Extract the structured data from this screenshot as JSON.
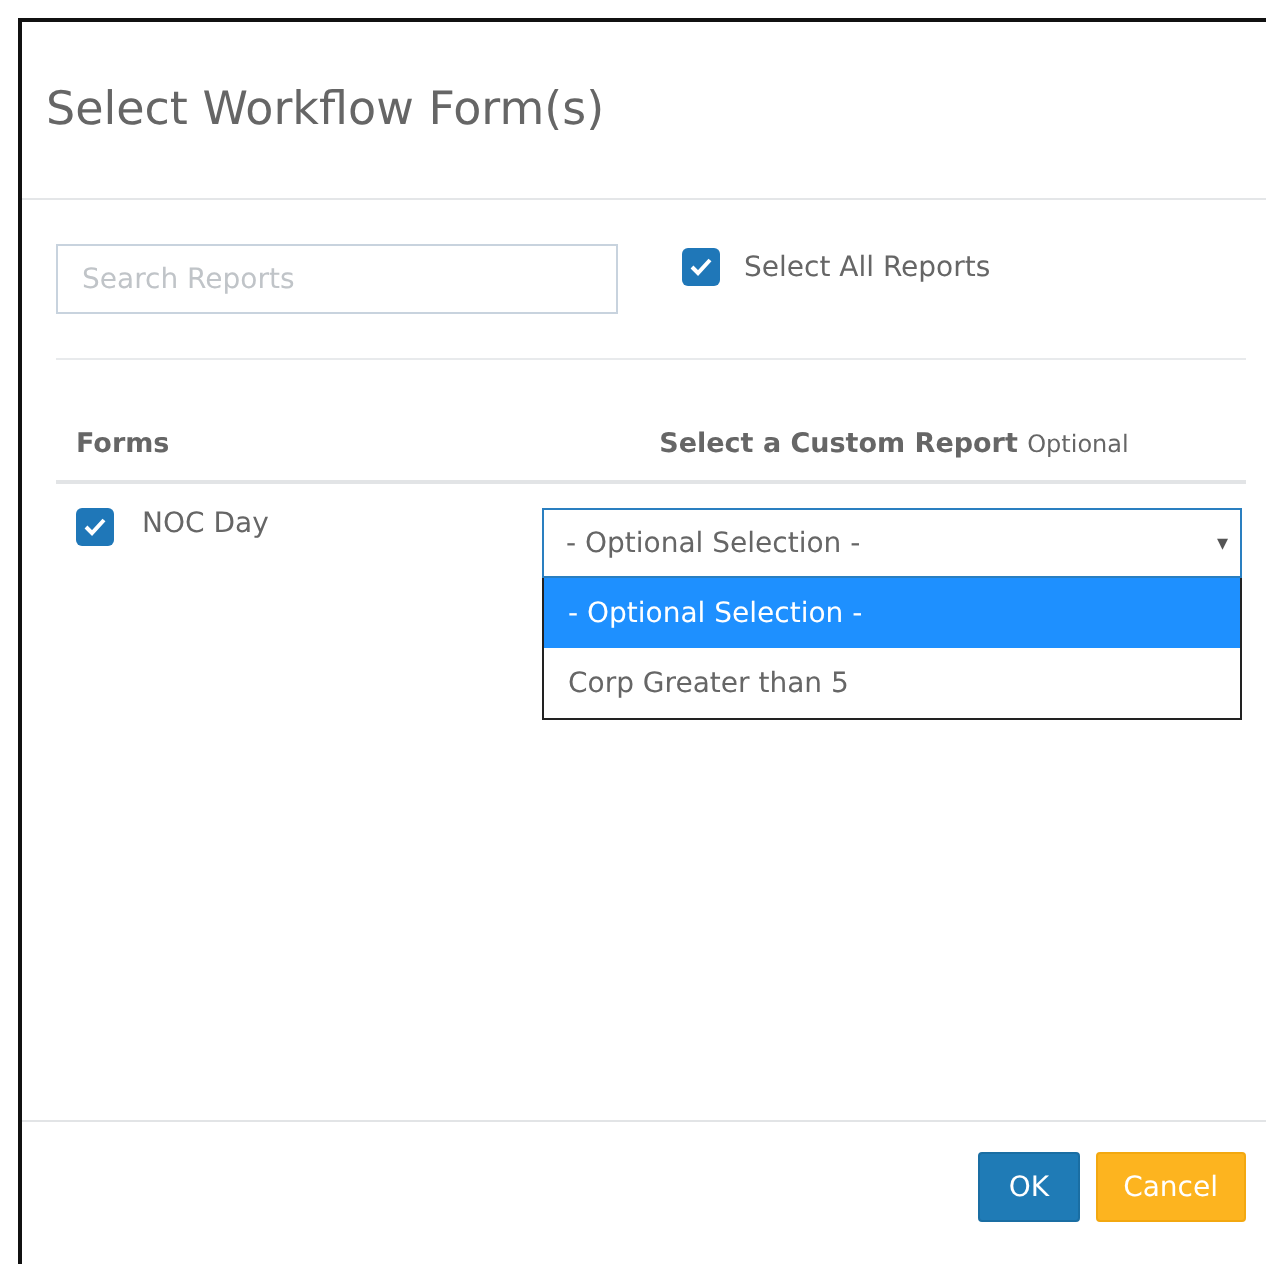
{
  "dialog": {
    "title": "Select Workflow Form(s)"
  },
  "search": {
    "placeholder": "Search Reports"
  },
  "select_all": {
    "label": "Select All Reports",
    "checked": true
  },
  "table": {
    "columns": [
      {
        "label": "Forms"
      },
      {
        "label": "Select a Custom Report",
        "hint": "Optional"
      }
    ],
    "rows": [
      {
        "name": "NOC Day",
        "checked": true,
        "dropdown": {
          "value": "- Optional Selection -",
          "arrow": "▾",
          "expanded": true,
          "options": [
            {
              "label": "- Optional Selection -",
              "selected": true
            },
            {
              "label": "Corp Greater than 5",
              "selected": false
            }
          ]
        }
      }
    ]
  },
  "buttons": [
    {
      "label": "OK",
      "kind": "primary"
    },
    {
      "label": "Cancel",
      "kind": "warning"
    }
  ]
}
